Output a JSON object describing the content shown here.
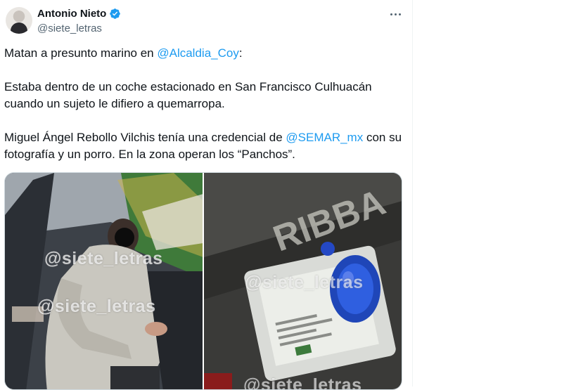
{
  "author": {
    "name": "Antonio Nieto",
    "handle": "@siete_letras"
  },
  "icons": {
    "verified": "verified-badge-icon",
    "more": "more-options-icon"
  },
  "colors": {
    "link": "#1d9bf0",
    "verified": "#1d9bf0",
    "secondary_text": "#536471"
  },
  "tweet": {
    "line1_prefix": "Matan a presunto marino en ",
    "line1_mention": "@Alcaldia_Coy",
    "line1_suffix": ":",
    "para2": "Estaba dentro de un coche estacionado en San Francisco Culhuacán cuando un sujeto le difiero a quemarropa.",
    "para3_prefix": "Miguel Ángel Rebollo Vilchis tenía una credencial de ",
    "para3_mention": "@SEMAR_mx",
    "para3_suffix": " con su fotografía y un porro. En la zona operan los “Panchos”."
  },
  "media": {
    "watermark": "@siete_letras",
    "left_photo_caption_mark": "RIBBA"
  }
}
